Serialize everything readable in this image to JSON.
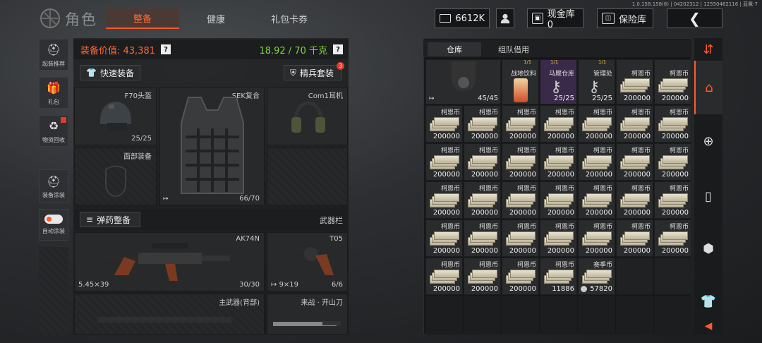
{
  "header": {
    "title": "角色",
    "version": "1.0.158.158(8) | 04202312 | 12550462116 | 蓝鹰-7",
    "tabs": [
      {
        "label": "整备",
        "active": true
      },
      {
        "label": "健康",
        "active": false
      },
      {
        "label": "礼包卡券",
        "active": false
      }
    ],
    "currency": "6612K",
    "cash_vault": "现金库 0",
    "safe_vault": "保险库"
  },
  "sidebar": [
    {
      "label": "起装推荐",
      "icon": "loadout-icon"
    },
    {
      "label": "礼包",
      "icon": "gift-icon"
    },
    {
      "label": "物资回收",
      "icon": "recycle-icon"
    },
    {
      "label": "装备涂装",
      "icon": "paint-icon"
    },
    {
      "label": "自动涂装",
      "icon": "toggle-icon"
    }
  ],
  "equipment": {
    "value_label": "装备价值: 43,381",
    "weight": "18.92 / 70 千克",
    "quick_equip": "快速装备",
    "elite_set": "精兵套装",
    "elite_badge": "3",
    "help": "?",
    "slots": {
      "helmet": {
        "name": "F70头盔",
        "count": "25/25"
      },
      "armor": {
        "name": "SEK复合",
        "count": "66/70"
      },
      "headset": {
        "name": "Com1耳机"
      },
      "face": {
        "name": "面部装备"
      }
    },
    "ammo_button": "弹药整备",
    "weapon_bar": "武器栏",
    "weapons": [
      {
        "name": "AK74N",
        "caliber": "5.45×39",
        "count": "30/30"
      },
      {
        "name": "T05",
        "caliber": "9×19",
        "count": "6/6"
      },
      {
        "name": "主武器(背部)"
      },
      {
        "name": "来战 · 开山刀"
      }
    ]
  },
  "storage": {
    "tabs": [
      {
        "label": "仓库",
        "active": true
      },
      {
        "label": "组队借用",
        "active": false
      }
    ],
    "special_items": [
      {
        "name": "",
        "qty": "45/45"
      },
      {
        "name": "战地饮料",
        "qty": ""
      },
      {
        "name": "马厩仓库",
        "qty": "25/25"
      },
      {
        "name": "管理处",
        "qty": "25/25"
      }
    ],
    "currency_name": "柯恩币",
    "stack_qty": "200000",
    "partial_qty": "11886",
    "token_name": "赛季币",
    "token_qty": "57820",
    "corner_tags": [
      "1/1",
      "1/1",
      "1/1"
    ]
  },
  "colors": {
    "accent": "#ff5a2a",
    "value": "#ff6a3a",
    "weight": "#7fd63a"
  }
}
